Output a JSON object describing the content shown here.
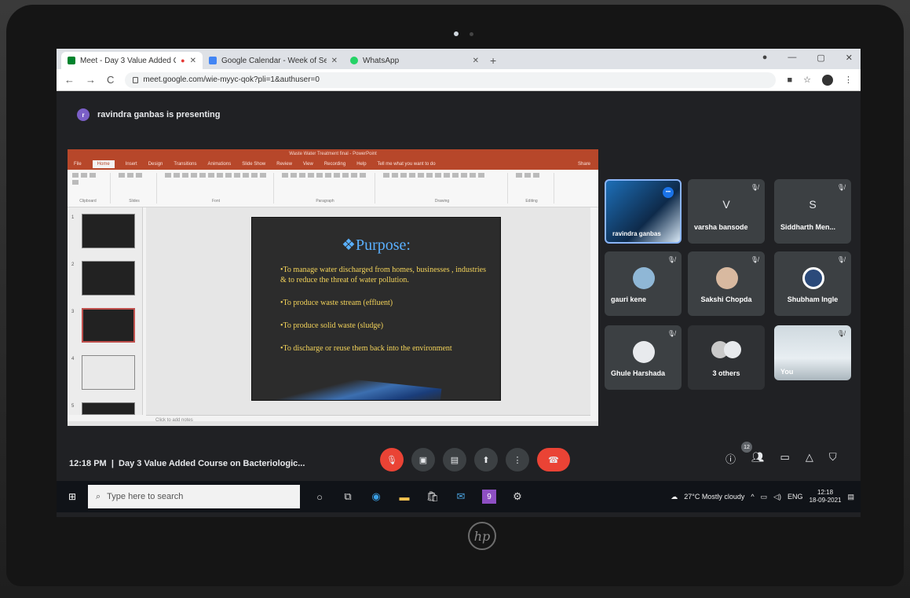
{
  "browser": {
    "tabs": [
      {
        "title": "Meet - Day 3 Value Added C",
        "favicon_color": "#00832d"
      },
      {
        "title": "Google Calendar - Week of Sept",
        "favicon_color": "#4285f4"
      },
      {
        "title": "WhatsApp",
        "favicon_color": "#25d366"
      }
    ],
    "new_tab": "+",
    "url": "meet.google.com/wie-myyc-qok?pli=1&authuser=0"
  },
  "meet": {
    "presenter_initial": "r",
    "presenting_text": "ravindra ganbas is presenting",
    "meeting_time": "12:18 PM",
    "meeting_title": "Day 3 Value Added Course on Bacteriologic...",
    "participant_count": "12",
    "participants": [
      {
        "name": "ravindra ganbas",
        "type": "video"
      },
      {
        "name": "varsha bansode",
        "letter": "V"
      },
      {
        "name": "Siddharth Men...",
        "letter": "S"
      },
      {
        "name": "gauri kene"
      },
      {
        "name": "Sakshi Chopda"
      },
      {
        "name": "Shubham Ingle"
      },
      {
        "name": "Ghule Harshada"
      },
      {
        "name": "3 others"
      },
      {
        "name": "You",
        "type": "video"
      }
    ]
  },
  "ppt": {
    "window_title": "Waste Water Treatment final - PowerPoint",
    "menu": [
      "File",
      "Home",
      "Insert",
      "Design",
      "Transitions",
      "Animations",
      "Slide Show",
      "Review",
      "View",
      "Recording",
      "Help",
      "Tell me what you want to do",
      "Share"
    ],
    "ribbon_groups": [
      "Clipboard",
      "Slides",
      "Font",
      "Paragraph",
      "Drawing",
      "Editing"
    ],
    "notes_placeholder": "Click to add notes",
    "slide": {
      "title": "❖Purpose:",
      "bullets": [
        "•To manage water discharged  from homes, businesses , industries & to reduce the threat of water pollution.",
        "•To produce waste stream (effluent)",
        "•To produce solid waste (sludge)",
        "•To discharge or reuse them back into the environment"
      ]
    }
  },
  "taskbar": {
    "search_placeholder": "Type here to search",
    "weather": "27°C  Mostly cloudy",
    "language": "ENG",
    "time": "12:18",
    "date": "18-09-2021"
  },
  "brand": "hp"
}
